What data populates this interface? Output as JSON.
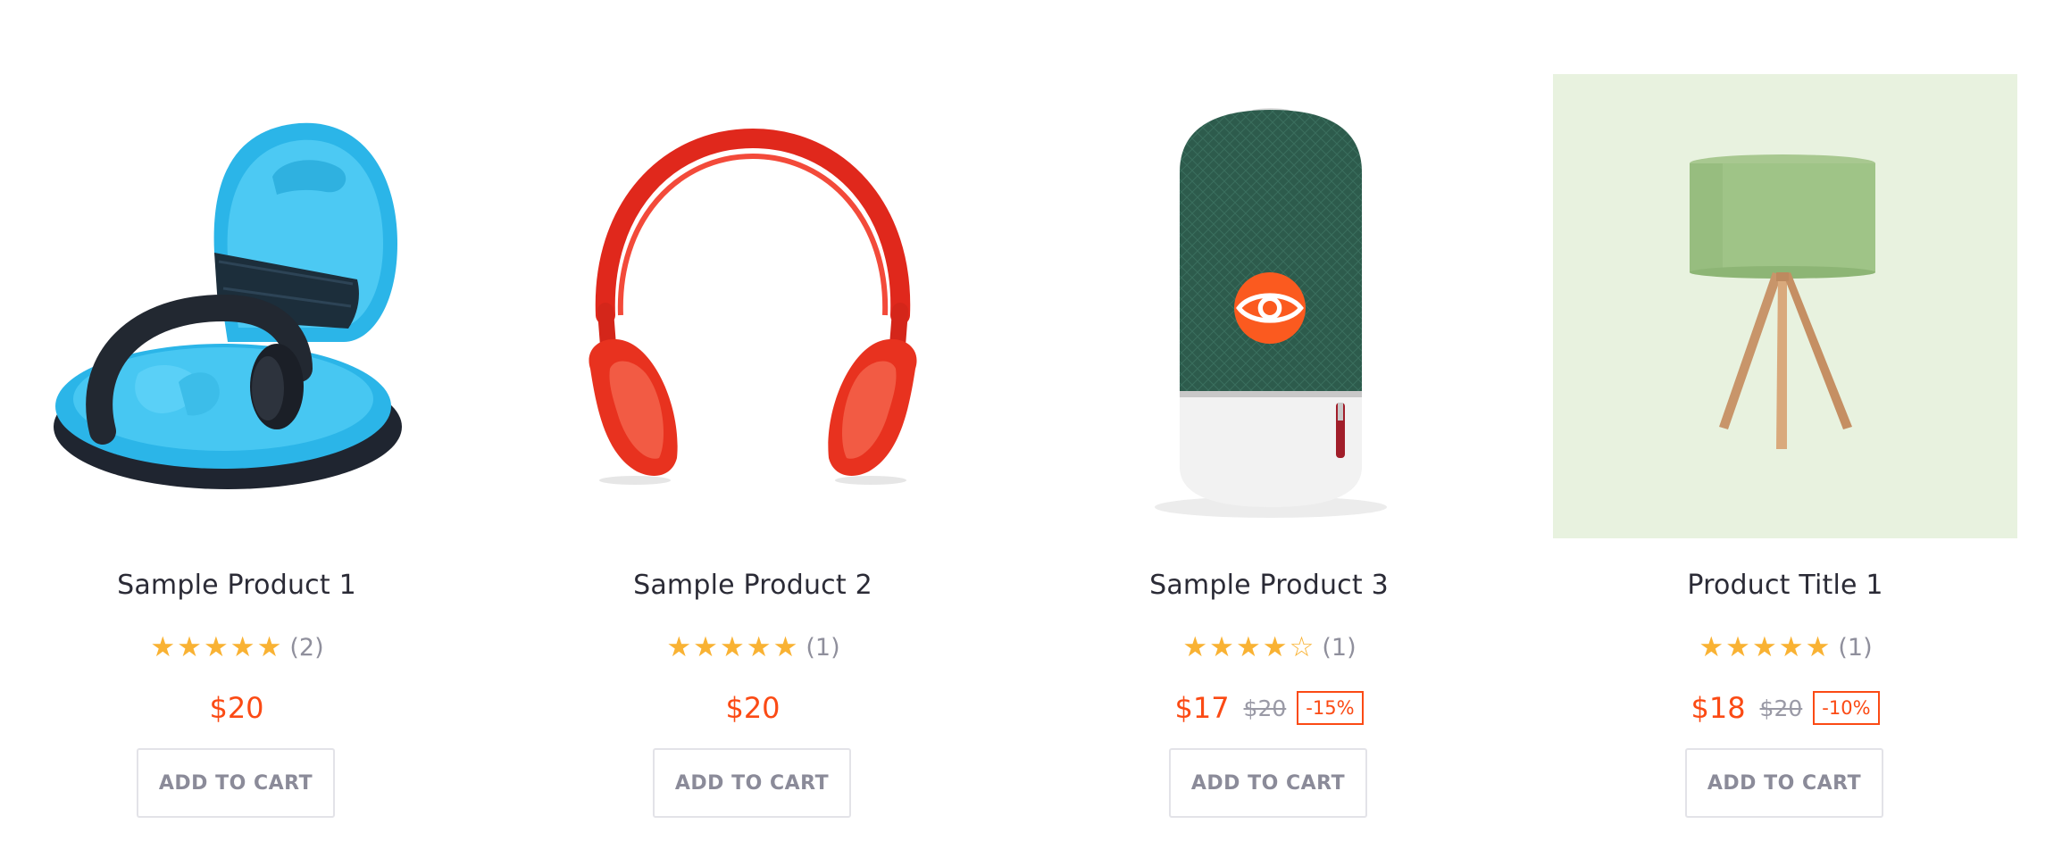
{
  "colors": {
    "accent": "#fb4a14",
    "star": "#f9b233",
    "title_text": "#2b2b36",
    "muted_text": "#8f8f9c",
    "quickview_bg": "#fb5a1f"
  },
  "products": [
    {
      "title": "Sample Product 1",
      "image": "headphone-case-image",
      "rating": 5,
      "rating_count": "(2)",
      "price": "$20",
      "old_price": "",
      "discount": "",
      "cart_label": "ADD TO CART"
    },
    {
      "title": "Sample Product 2",
      "image": "red-headphones-image",
      "rating": 5,
      "rating_count": "(1)",
      "price": "$20",
      "old_price": "",
      "discount": "",
      "cart_label": "ADD TO CART"
    },
    {
      "title": "Sample Product 3",
      "image": "green-speaker-image",
      "rating": 4,
      "rating_count": "(1)",
      "price": "$17",
      "old_price": "$20",
      "discount": "-15%",
      "cart_label": "ADD TO CART",
      "quickview_icon": "eye-icon"
    },
    {
      "title": "Product Title 1",
      "image": "tripod-lamp-image",
      "rating": 5,
      "rating_count": "(1)",
      "price": "$18",
      "old_price": "$20",
      "discount": "-10%",
      "cart_label": "ADD TO CART"
    }
  ]
}
